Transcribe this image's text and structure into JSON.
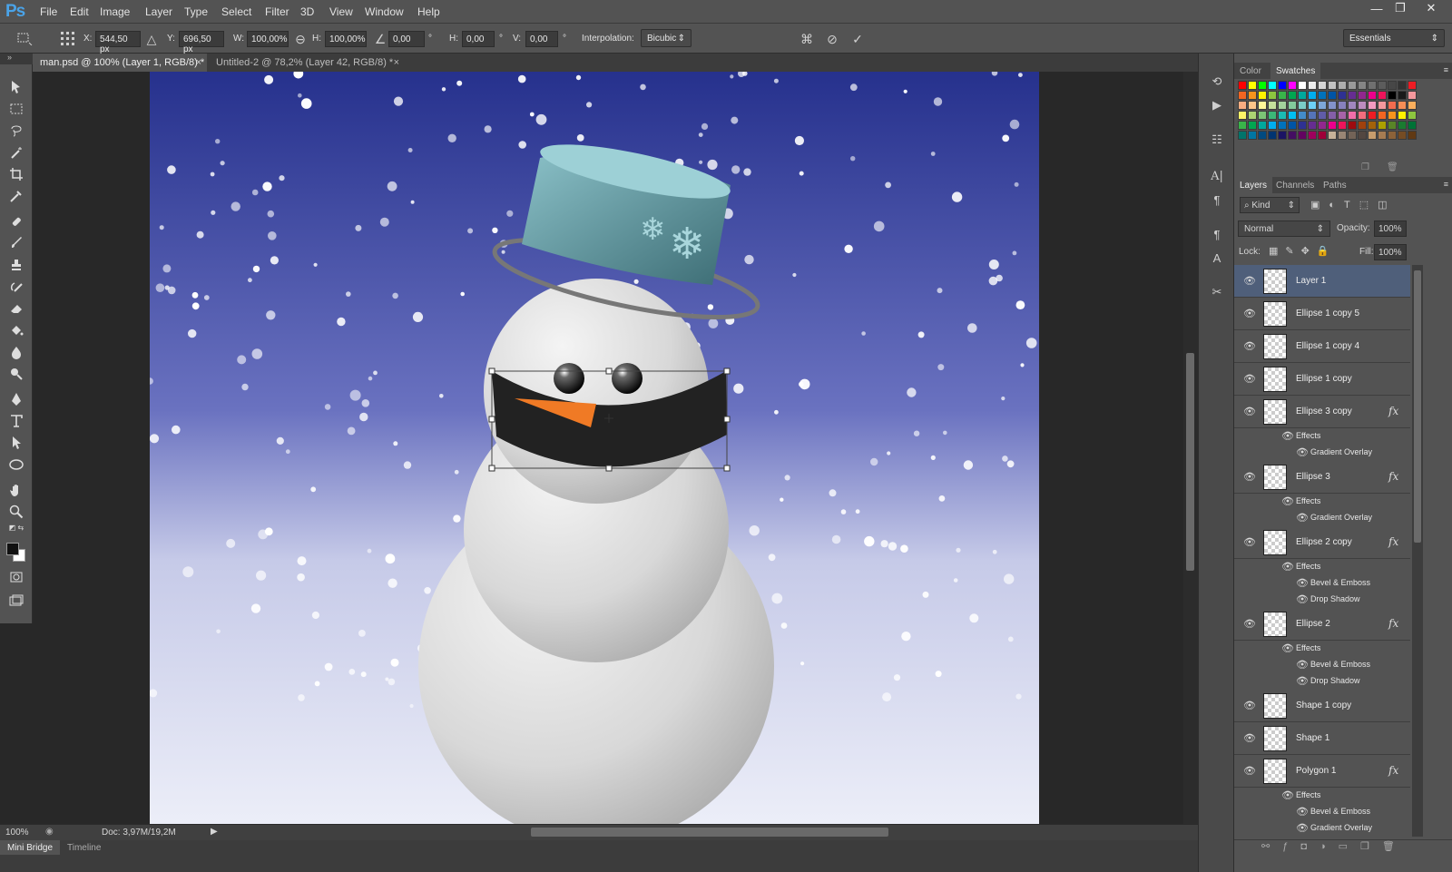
{
  "app": {
    "logo": "Ps"
  },
  "menu": [
    "File",
    "Edit",
    "Image",
    "Layer",
    "Type",
    "Select",
    "Filter",
    "3D",
    "View",
    "Window",
    "Help"
  ],
  "window_controls": {
    "minimize": "—",
    "restore": "❐",
    "close": "✕"
  },
  "options": {
    "x_label": "X:",
    "x_value": "544,50 px",
    "y_label": "Y:",
    "y_value": "696,50 px",
    "w_label": "W:",
    "w_value": "100,00%",
    "h_label": "H:",
    "h_value": "100,00%",
    "angle_value": "0,00",
    "hskew_label": "H:",
    "hskew_value": "0,00",
    "vskew_label": "V:",
    "vskew_value": "0,00",
    "degree": "°",
    "interp_label": "Interpolation:",
    "interp_value": "Bicubic",
    "workspace": "Essentials"
  },
  "tabs": [
    {
      "label": "man.psd @ 100% (Layer 1, RGB/8) *",
      "close": "×",
      "active": true
    },
    {
      "label": "Untitled-2 @ 78,2% (Layer 42, RGB/8) *",
      "close": "×",
      "active": false
    }
  ],
  "status": {
    "zoom": "100%",
    "doc": "Doc: 3,97M/19,2M"
  },
  "bottom_tabs": [
    "Mini Bridge",
    "Timeline"
  ],
  "color_panel": {
    "tabs": [
      "Color",
      "Swatches"
    ],
    "active": "Swatches"
  },
  "layers_panel": {
    "tabs": [
      "Layers",
      "Channels",
      "Paths"
    ],
    "kind": "Kind",
    "blend_mode": "Normal",
    "opacity_label": "Opacity:",
    "opacity_value": "100%",
    "lock_label": "Lock:",
    "fill_label": "Fill:",
    "fill_value": "100%",
    "layers": [
      {
        "name": "Layer 1",
        "selected": true,
        "fx": false
      },
      {
        "name": "Ellipse 1 copy 5",
        "fx": false
      },
      {
        "name": "Ellipse 1 copy 4",
        "fx": false
      },
      {
        "name": "Ellipse 1 copy",
        "fx": false
      },
      {
        "name": "Ellipse 3 copy",
        "fx": true,
        "effects": [
          "Gradient Overlay"
        ]
      },
      {
        "name": "Ellipse 3",
        "fx": true,
        "effects": [
          "Gradient Overlay"
        ]
      },
      {
        "name": "Ellipse 2 copy",
        "fx": true,
        "effects": [
          "Bevel & Emboss",
          "Drop Shadow"
        ]
      },
      {
        "name": "Ellipse 2",
        "fx": true,
        "effects": [
          "Bevel & Emboss",
          "Drop Shadow"
        ]
      },
      {
        "name": "Shape 1 copy",
        "fx": false
      },
      {
        "name": "Shape 1",
        "fx": false
      },
      {
        "name": "Polygon 1",
        "fx": true,
        "effects": [
          "Bevel & Emboss",
          "Gradient Overlay"
        ]
      }
    ],
    "effects_label": "Effects",
    "fx_symbol": "fx"
  },
  "colors": {
    "accent": "#4f5f7a",
    "canvas_top": "#2a3590",
    "canvas_bottom": "#e9ebf6",
    "carrot": "#f07a25",
    "hat": "#5a8f95"
  }
}
